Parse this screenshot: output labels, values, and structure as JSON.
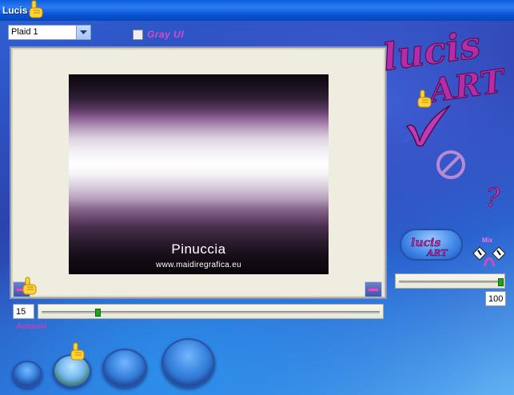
{
  "window": {
    "title": "Lucis"
  },
  "preset": {
    "selected": "Plaid 1"
  },
  "gray_ui": {
    "label": "Gray UI",
    "checked": false
  },
  "preview": {
    "watermark_name": "Pinuccia",
    "watermark_url": "www.maidiregrafica.eu"
  },
  "amount": {
    "value": "15",
    "label": "Amount",
    "slider_fraction": 0.16
  },
  "mix": {
    "value": "100",
    "label": "Mix",
    "slider_fraction": 1.0
  },
  "logo": {
    "text": "lucis art"
  },
  "icons": {
    "ok": "checkmark-icon",
    "cancel": "cancel-icon",
    "help": "question-mark-icon",
    "pointer": "hand-pointer-icon"
  },
  "colors": {
    "accent": "#d84ac8",
    "title_bar": "#0a5fe0",
    "slider_thumb": "#21a121"
  }
}
